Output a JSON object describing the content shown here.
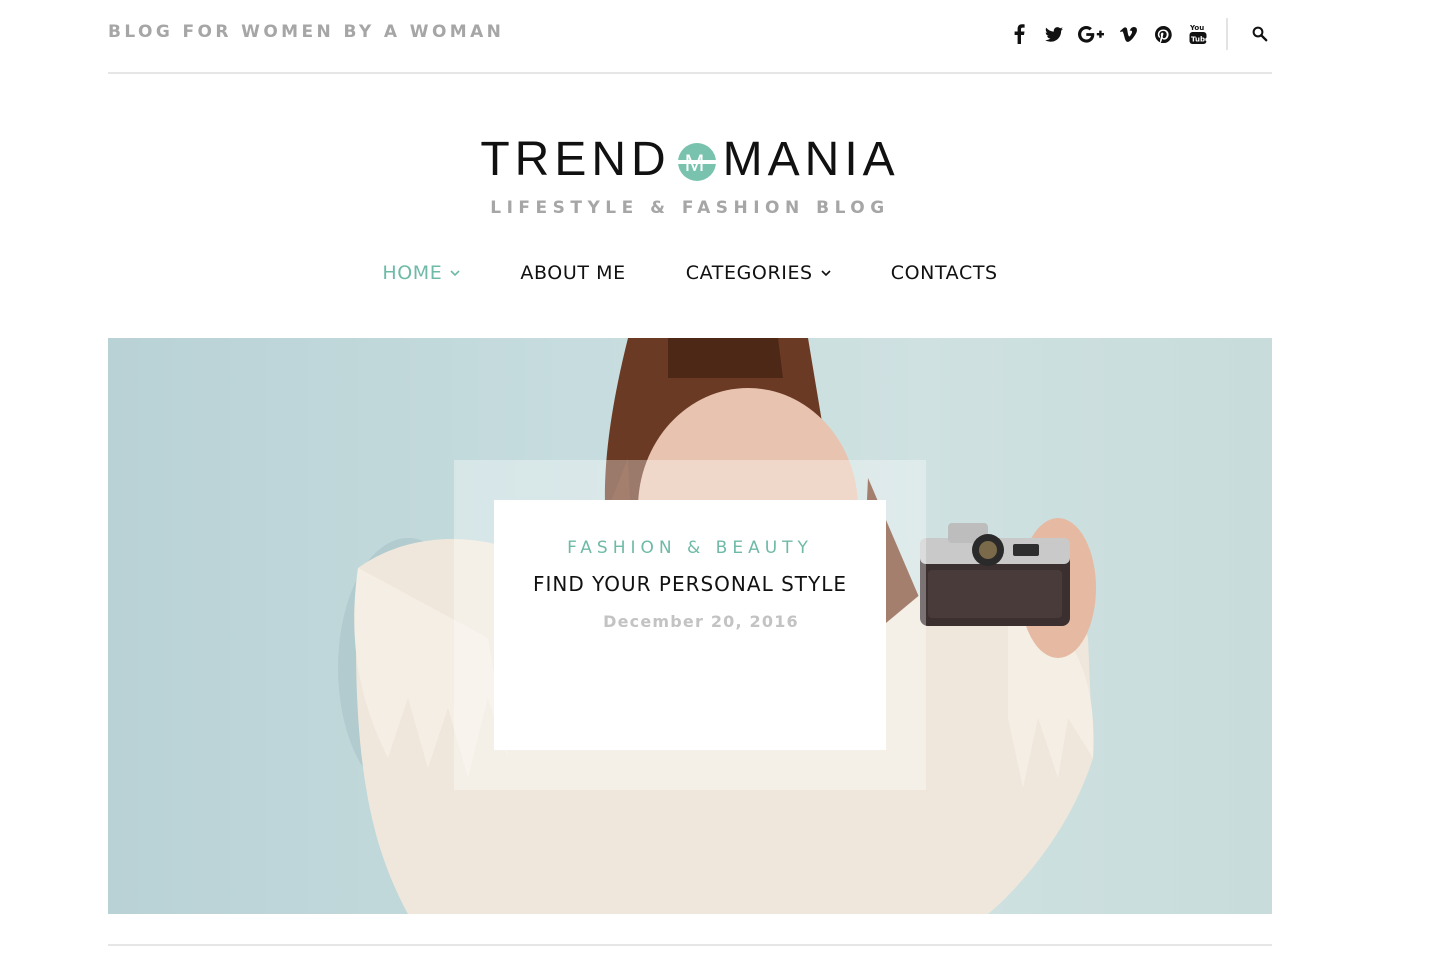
{
  "header": {
    "tagline": "BLOG FOR WOMEN BY A WOMAN",
    "social_icons": [
      "facebook-icon",
      "twitter-icon",
      "google-plus-icon",
      "vimeo-icon",
      "pinterest-icon",
      "youtube-icon"
    ],
    "search_icon": "search-icon"
  },
  "brand": {
    "logo_left": "TREND",
    "logo_right": "MANIA",
    "logo_mark_letter": "M",
    "subtitle": "LIFESTYLE & FASHION BLOG"
  },
  "nav": {
    "items": [
      {
        "label": "HOME",
        "has_dropdown": true,
        "active": true
      },
      {
        "label": "ABOUT ME",
        "has_dropdown": false,
        "active": false
      },
      {
        "label": "CATEGORIES",
        "has_dropdown": true,
        "active": false
      },
      {
        "label": "CONTACTS",
        "has_dropdown": false,
        "active": false
      }
    ]
  },
  "featured": {
    "category": "FASHION & BEAUTY",
    "title": "FIND YOUR PERSONAL STYLE",
    "date": "December 20, 2016"
  },
  "colors": {
    "accent": "#6fbaa7",
    "muted": "#a6a6a6",
    "text": "#111111",
    "hero_background": "#c6dcde"
  }
}
